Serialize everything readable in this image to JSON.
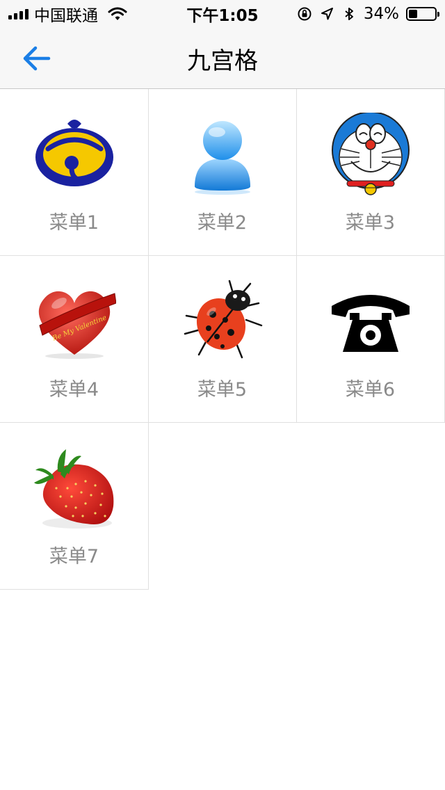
{
  "status_bar": {
    "carrier": "中国联通",
    "time": "下午1:05",
    "battery": "34%",
    "battery_level": 0.34,
    "icons": [
      "signal-icon",
      "wifi-icon",
      "orientation-lock-icon",
      "location-icon",
      "bluetooth-icon",
      "battery-icon"
    ]
  },
  "nav": {
    "title": "九宫格",
    "back_icon": "arrow-left-icon",
    "accent_color": "#1a7ee6"
  },
  "menu": {
    "items": [
      {
        "label": "菜单1",
        "icon": "bell-icon"
      },
      {
        "label": "菜单2",
        "icon": "user-icon"
      },
      {
        "label": "菜单3",
        "icon": "doraemon-icon"
      },
      {
        "label": "菜单4",
        "icon": "heart-icon",
        "badge_text": "Be My Valentine"
      },
      {
        "label": "菜单5",
        "icon": "ladybug-icon"
      },
      {
        "label": "菜单6",
        "icon": "telephone-icon"
      },
      {
        "label": "菜单7",
        "icon": "strawberry-icon"
      }
    ]
  }
}
